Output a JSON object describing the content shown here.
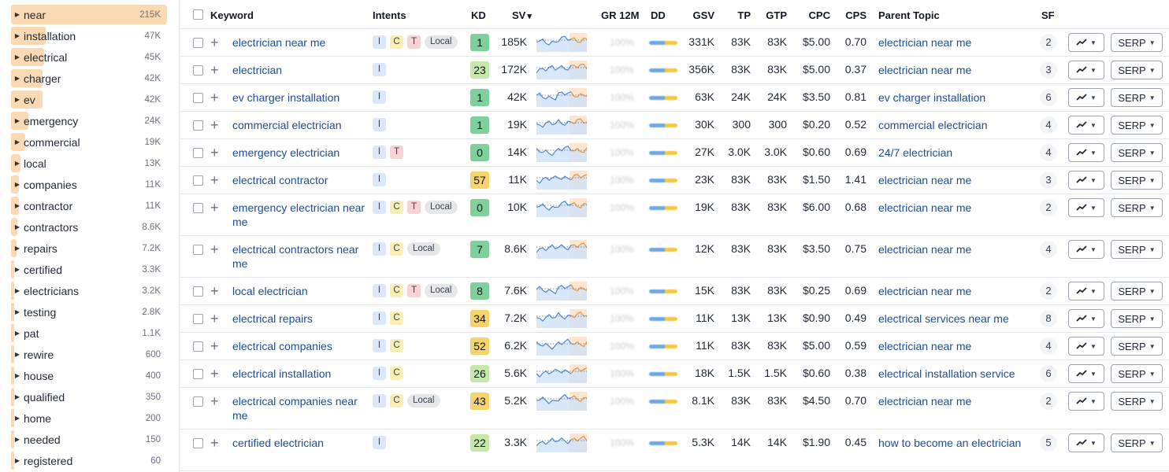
{
  "colors": {
    "kd_green": "#7ed19a",
    "kd_lightgreen": "#c6e8a8",
    "kd_yellow": "#f6d36b",
    "link": "#1e4d91",
    "sidebar_bar": "#fbd9b2"
  },
  "sidebar": {
    "items": [
      {
        "label": "near",
        "count": "215K",
        "fill": 1.0,
        "selected": true
      },
      {
        "label": "installation",
        "count": "47K",
        "fill": 0.22
      },
      {
        "label": "electrical",
        "count": "45K",
        "fill": 0.21
      },
      {
        "label": "charger",
        "count": "42K",
        "fill": 0.2
      },
      {
        "label": "ev",
        "count": "42K",
        "fill": 0.2
      },
      {
        "label": "emergency",
        "count": "24K",
        "fill": 0.11
      },
      {
        "label": "commercial",
        "count": "19K",
        "fill": 0.09
      },
      {
        "label": "local",
        "count": "13K",
        "fill": 0.06
      },
      {
        "label": "companies",
        "count": "11K",
        "fill": 0.05
      },
      {
        "label": "contractor",
        "count": "11K",
        "fill": 0.05
      },
      {
        "label": "contractors",
        "count": "8.6K",
        "fill": 0.04
      },
      {
        "label": "repairs",
        "count": "7.2K",
        "fill": 0.033
      },
      {
        "label": "certified",
        "count": "3.3K",
        "fill": 0.015
      },
      {
        "label": "electricians",
        "count": "3.2K",
        "fill": 0.015
      },
      {
        "label": "testing",
        "count": "2.8K",
        "fill": 0.013
      },
      {
        "label": "pat",
        "count": "1.1K",
        "fill": 0.005
      },
      {
        "label": "rewire",
        "count": "600",
        "fill": 0.003
      },
      {
        "label": "house",
        "count": "400",
        "fill": 0.002
      },
      {
        "label": "qualified",
        "count": "350",
        "fill": 0.0016
      },
      {
        "label": "home",
        "count": "200",
        "fill": 0.001
      },
      {
        "label": "needed",
        "count": "150",
        "fill": 0.0007
      },
      {
        "label": "registered",
        "count": "60",
        "fill": 0.0003
      }
    ]
  },
  "table": {
    "headers": {
      "keyword": "Keyword",
      "intents": "Intents",
      "kd": "KD",
      "sv": "SV",
      "sv_sort": "▾",
      "gr": "GR 12M",
      "dd": "DD",
      "gsv": "GSV",
      "tp": "TP",
      "gtp": "GTP",
      "cpc": "CPC",
      "cps": "CPS",
      "parent": "Parent Topic",
      "sf": "SF"
    },
    "serp_label": "SERP",
    "rows": [
      {
        "keyword": "electrician near me",
        "intents": [
          "I",
          "C",
          "T",
          "Local"
        ],
        "kd": "1",
        "kd_color": "green",
        "sv": "185K",
        "gr": "100%",
        "gsv": "331K",
        "tp": "83K",
        "gtp": "83K",
        "cpc": "$5.00",
        "cps": "0.70",
        "parent": "electrician near me",
        "sf": "2",
        "lines": 1
      },
      {
        "keyword": "electrician",
        "intents": [
          "I"
        ],
        "kd": "23",
        "kd_color": "lightgreen",
        "sv": "172K",
        "gr": "100%",
        "gsv": "356K",
        "tp": "83K",
        "gtp": "83K",
        "cpc": "$5.00",
        "cps": "0.37",
        "parent": "electrician near me",
        "sf": "3",
        "lines": 1
      },
      {
        "keyword": "ev charger installation",
        "intents": [
          "I"
        ],
        "kd": "1",
        "kd_color": "green",
        "sv": "42K",
        "gr": "100%",
        "gsv": "63K",
        "tp": "24K",
        "gtp": "24K",
        "cpc": "$3.50",
        "cps": "0.81",
        "parent": "ev charger installation",
        "sf": "6",
        "lines": 1
      },
      {
        "keyword": "commercial electrician",
        "intents": [
          "I"
        ],
        "kd": "1",
        "kd_color": "green",
        "sv": "19K",
        "gr": "100%",
        "gsv": "30K",
        "tp": "300",
        "gtp": "300",
        "cpc": "$0.20",
        "cps": "0.52",
        "parent": "commercial electrician",
        "sf": "4",
        "lines": 1
      },
      {
        "keyword": "emergency electrician",
        "intents": [
          "I",
          "T"
        ],
        "kd": "0",
        "kd_color": "green",
        "sv": "14K",
        "gr": "100%",
        "gsv": "27K",
        "tp": "3.0K",
        "gtp": "3.0K",
        "cpc": "$0.60",
        "cps": "0.69",
        "parent": "24/7 electrician",
        "sf": "4",
        "lines": 1
      },
      {
        "keyword": "electrical contractor",
        "intents": [
          "I"
        ],
        "kd": "57",
        "kd_color": "yellow",
        "sv": "11K",
        "gr": "100%",
        "gsv": "23K",
        "tp": "83K",
        "gtp": "83K",
        "cpc": "$1.50",
        "cps": "1.41",
        "parent": "electrician near me",
        "sf": "3",
        "lines": 1
      },
      {
        "keyword": "emergency electrician near me",
        "intents": [
          "I",
          "C",
          "T",
          "Local"
        ],
        "kd": "0",
        "kd_color": "green",
        "sv": "10K",
        "gr": "100%",
        "gsv": "19K",
        "tp": "83K",
        "gtp": "83K",
        "cpc": "$6.00",
        "cps": "0.68",
        "parent": "electrician near me",
        "sf": "2",
        "lines": 2
      },
      {
        "keyword": "electrical contractors near me",
        "intents": [
          "I",
          "C",
          "Local"
        ],
        "kd": "7",
        "kd_color": "green",
        "sv": "8.6K",
        "gr": "100%",
        "gsv": "12K",
        "tp": "83K",
        "gtp": "83K",
        "cpc": "$3.50",
        "cps": "0.75",
        "parent": "electrician near me",
        "sf": "4",
        "lines": 2
      },
      {
        "keyword": "local electrician",
        "intents": [
          "I",
          "C",
          "T",
          "Local"
        ],
        "kd": "8",
        "kd_color": "green",
        "sv": "7.6K",
        "gr": "100%",
        "gsv": "15K",
        "tp": "83K",
        "gtp": "83K",
        "cpc": "$0.25",
        "cps": "0.69",
        "parent": "electrician near me",
        "sf": "2",
        "lines": 1
      },
      {
        "keyword": "electrical repairs",
        "intents": [
          "I",
          "C"
        ],
        "kd": "34",
        "kd_color": "yellow",
        "sv": "7.2K",
        "gr": "100%",
        "gsv": "11K",
        "tp": "13K",
        "gtp": "13K",
        "cpc": "$0.90",
        "cps": "0.49",
        "parent": "electrical services near me",
        "sf": "8",
        "lines": 1
      },
      {
        "keyword": "electrical companies",
        "intents": [
          "I",
          "C"
        ],
        "kd": "52",
        "kd_color": "yellow",
        "sv": "6.2K",
        "gr": "100%",
        "gsv": "11K",
        "tp": "83K",
        "gtp": "83K",
        "cpc": "$5.00",
        "cps": "0.59",
        "parent": "electrician near me",
        "sf": "4",
        "lines": 1
      },
      {
        "keyword": "electrical installation",
        "intents": [
          "I",
          "C"
        ],
        "kd": "26",
        "kd_color": "lightgreen",
        "sv": "5.6K",
        "gr": "100%",
        "gsv": "18K",
        "tp": "1.5K",
        "gtp": "1.5K",
        "cpc": "$0.60",
        "cps": "0.38",
        "parent": "electrical installation service",
        "sf": "6",
        "lines": 1
      },
      {
        "keyword": "electrical companies near me",
        "intents": [
          "I",
          "C",
          "Local"
        ],
        "kd": "43",
        "kd_color": "yellow",
        "sv": "5.2K",
        "gr": "100%",
        "gsv": "8.1K",
        "tp": "83K",
        "gtp": "83K",
        "cpc": "$4.50",
        "cps": "0.70",
        "parent": "electrician near me",
        "sf": "2",
        "lines": 2
      },
      {
        "keyword": "certified electrician",
        "intents": [
          "I"
        ],
        "kd": "22",
        "kd_color": "lightgreen",
        "sv": "3.3K",
        "gr": "100%",
        "gsv": "5.3K",
        "tp": "14K",
        "gtp": "14K",
        "cpc": "$1.90",
        "cps": "0.45",
        "parent": "how to become an electrician",
        "sf": "5",
        "lines": 2
      }
    ]
  }
}
